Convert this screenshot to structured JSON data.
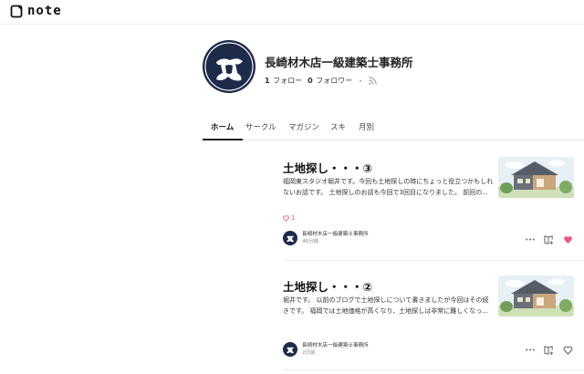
{
  "header": {
    "logo_text": "note"
  },
  "profile": {
    "name": "長崎材木店一級建築士事務所",
    "following_count": "1",
    "following_label": "フォロー",
    "followers_count": "0",
    "followers_label": "フォロワー"
  },
  "tabs": [
    {
      "label": "ホーム",
      "active": true
    },
    {
      "label": "サークル"
    },
    {
      "label": "マガジン"
    },
    {
      "label": "スキ"
    },
    {
      "label": "月別"
    }
  ],
  "articles": [
    {
      "title": "土地探し・・・③",
      "excerpt": "福岡東スタジオ堀井です。今回も土地探しの時にちょっと役立つかもしれないお話です。 土地探しのお話も今回で3回目になりました。 前回の...",
      "like_count": "1",
      "author": "長崎材木店一級建築士事務所",
      "time": "46分前",
      "liked": true
    },
    {
      "title": "土地探し・・・②",
      "excerpt": "堀井です。 以前のブログで土地探しについて書きましたが今回はその続きです。 福岡では土地価格が高くなり、土地探しは非常に難しくなっ...",
      "author": "長崎材木店一級建築士事務所",
      "time": "2日前",
      "liked": false
    }
  ],
  "colors": {
    "accent_like": "#e65b7a",
    "brand_navy": "#1e2a4a",
    "logo_green": "#2cb696"
  }
}
